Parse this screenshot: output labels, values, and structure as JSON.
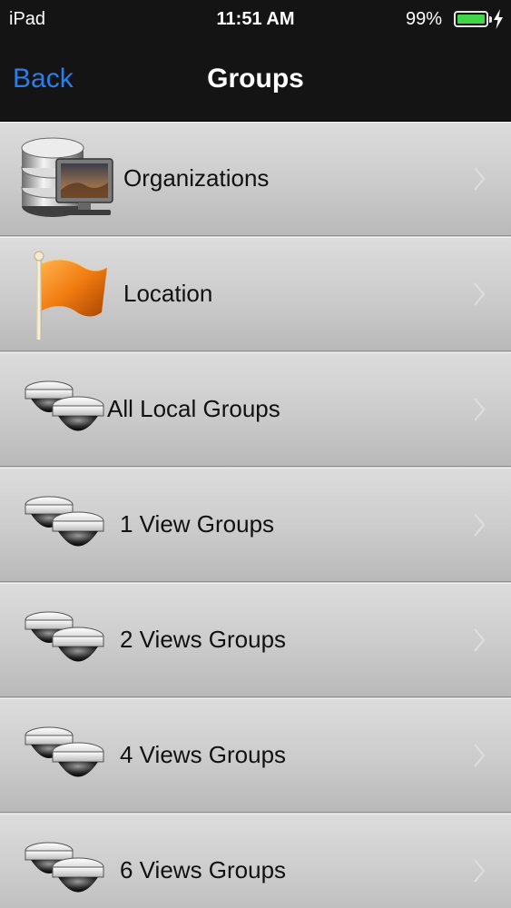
{
  "status_bar": {
    "device": "iPad",
    "time": "11:51 AM",
    "battery_percent": "99%",
    "battery_level": 0.99,
    "battery_color": "#41d64a",
    "charging_icon": "lightning-bolt-icon"
  },
  "nav_bar": {
    "back_label": "Back",
    "title": "Groups",
    "back_color": "#2b7de9"
  },
  "rows": [
    {
      "label": "Organizations",
      "icon": "database-computer-icon"
    },
    {
      "label": "Location",
      "icon": "orange-flag-icon"
    },
    {
      "label": "All Local Groups",
      "icon": "dome-cameras-icon"
    },
    {
      "label": "1 View Groups",
      "icon": "dome-cameras-icon"
    },
    {
      "label": "2 Views Groups",
      "icon": "dome-cameras-icon"
    },
    {
      "label": "4 Views Groups",
      "icon": "dome-cameras-icon"
    },
    {
      "label": "6 Views Groups",
      "icon": "dome-cameras-icon"
    }
  ]
}
